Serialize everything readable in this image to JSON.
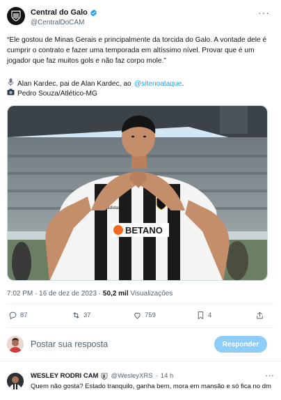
{
  "tweet": {
    "display_name": "Central do Galo",
    "handle": "@CentralDoCAM",
    "more_glyph": "···",
    "text": "“Ele gostou de Minas Gerais e principalmente da torcida do Galo. A vontade dele é cumprir o contrato e fazer uma temporada em altíssimo nível. Provar que é um jogador que faz muitos gols e não faz corpo mole.”",
    "credit_line": {
      "icon": "microphone-icon",
      "text_before": "Alan Kardec, pai de Alan Kardec, ao",
      "mention": "@sitenoataque",
      "text_after": "."
    },
    "photo_credit": {
      "icon": "camera-icon",
      "text": "Pedro Souza/Atlético-MG"
    },
    "media": {
      "sponsor_text": "BETANO",
      "kit_brand": "adidas"
    },
    "meta": {
      "time": "7:02 PM",
      "separator": "·",
      "date": "16 de dez de 2023",
      "views_count": "50,2 mil",
      "views_label": "Visualizações"
    },
    "actions": {
      "replies": "87",
      "retweets": "37",
      "likes": "759",
      "bookmarks": "4"
    }
  },
  "reply_box": {
    "placeholder": "Postar sua resposta",
    "button_label": "Responder"
  },
  "comment": {
    "name": "WESLEY RODRI CAM",
    "handle": "@WesleyXRS",
    "separator": "·",
    "time": "14 h",
    "more_glyph": "···",
    "text": "Quem não gosta? Estado tranquilo, ganha bem, mora em mansão e só fica no dm"
  },
  "colors": {
    "accent": "#1d9bf0",
    "muted": "#536471",
    "reply_button": "#8ecdf8",
    "jersey_black": "#1a1a1a",
    "jersey_white": "#f4f4f4"
  }
}
